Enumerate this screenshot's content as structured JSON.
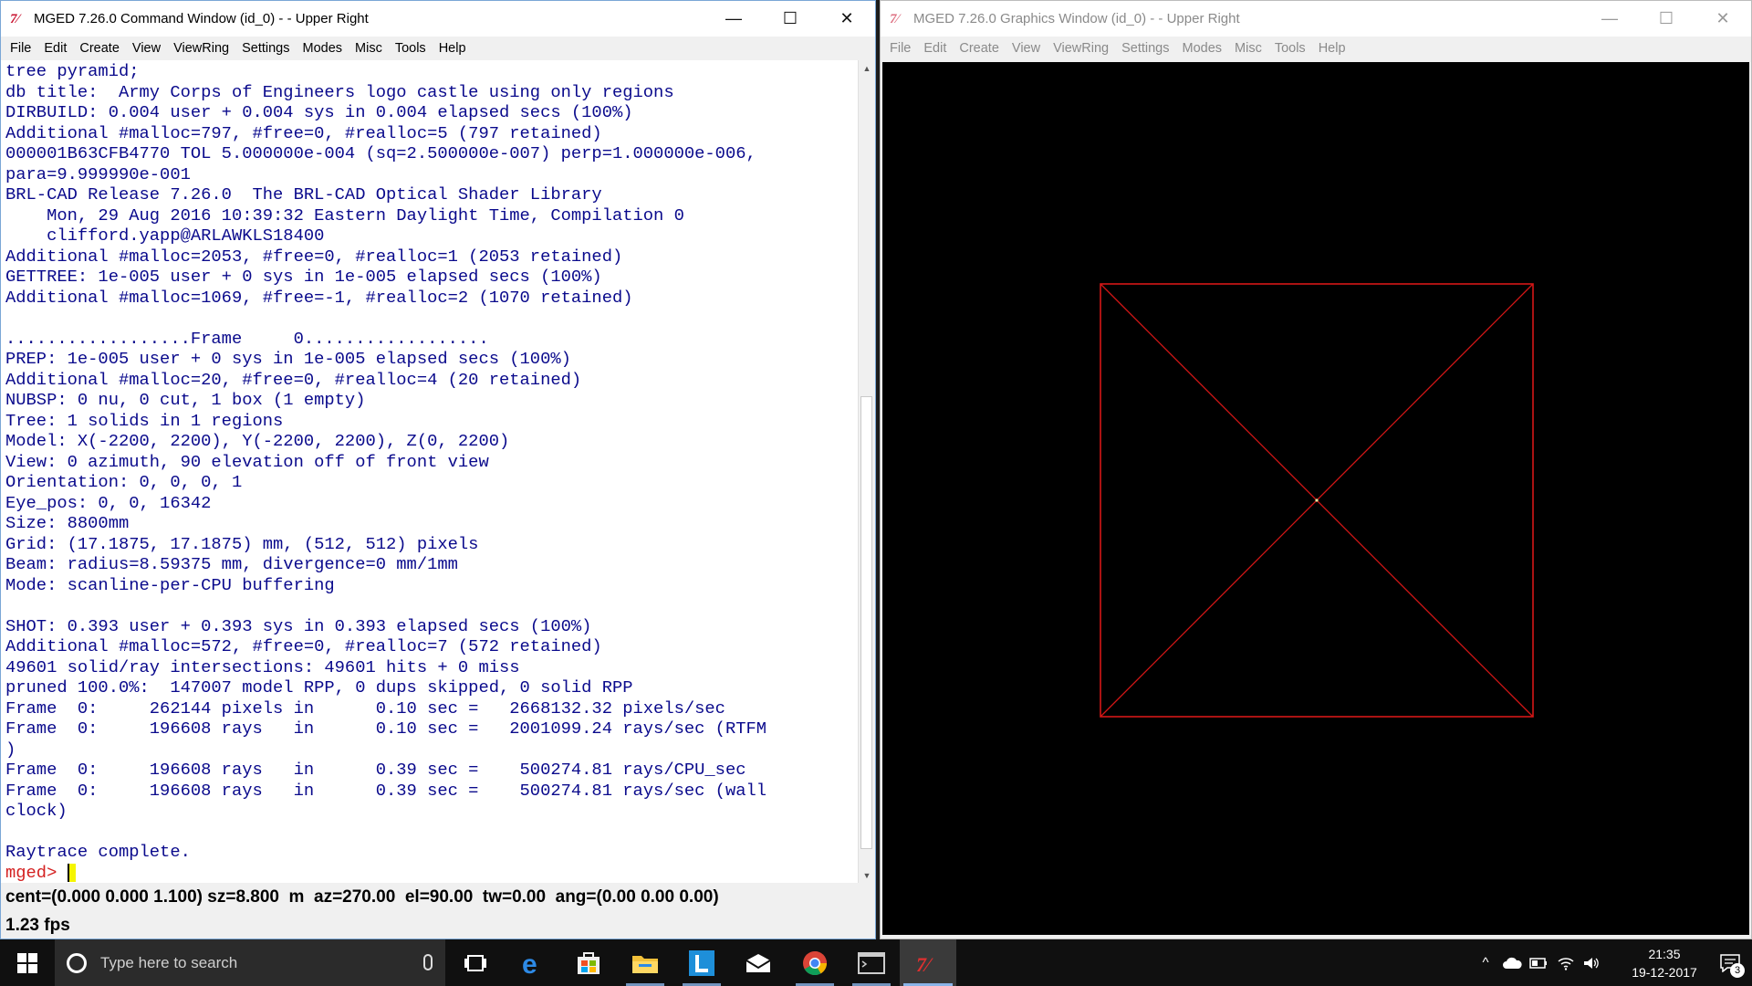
{
  "command_window": {
    "title": "MGED 7.26.0 Command Window (id_0) -  - Upper Right",
    "icon_glyph": "7⁄",
    "controls": {
      "minimize": "—",
      "maximize": "☐",
      "close": "✕"
    },
    "menu": [
      "File",
      "Edit",
      "Create",
      "View",
      "ViewRing",
      "Settings",
      "Modes",
      "Misc",
      "Tools",
      "Help"
    ],
    "console_lines": [
      "tree pyramid;",
      "db title:  Army Corps of Engineers logo castle using only regions",
      "DIRBUILD: 0.004 user + 0.004 sys in 0.004 elapsed secs (100%)",
      "Additional #malloc=797, #free=0, #realloc=5 (797 retained)",
      "000001B63CFB4770 TOL 5.000000e-004 (sq=2.500000e-007) perp=1.000000e-006,",
      "para=9.999990e-001",
      "BRL-CAD Release 7.26.0  The BRL-CAD Optical Shader Library",
      "    Mon, 29 Aug 2016 10:39:32 Eastern Daylight Time, Compilation 0",
      "    clifford.yapp@ARLAWKLS18400",
      "Additional #malloc=2053, #free=0, #realloc=1 (2053 retained)",
      "GETTREE: 1e-005 user + 0 sys in 1e-005 elapsed secs (100%)",
      "Additional #malloc=1069, #free=-1, #realloc=2 (1070 retained)",
      "",
      "..................Frame     0..................",
      "PREP: 1e-005 user + 0 sys in 1e-005 elapsed secs (100%)",
      "Additional #malloc=20, #free=0, #realloc=4 (20 retained)",
      "NUBSP: 0 nu, 0 cut, 1 box (1 empty)",
      "Tree: 1 solids in 1 regions",
      "Model: X(-2200, 2200), Y(-2200, 2200), Z(0, 2200)",
      "View: 0 azimuth, 90 elevation off of front view",
      "Orientation: 0, 0, 0, 1",
      "Eye_pos: 0, 0, 16342",
      "Size: 8800mm",
      "Grid: (17.1875, 17.1875) mm, (512, 512) pixels",
      "Beam: radius=8.59375 mm, divergence=0 mm/1mm",
      "Mode: scanline-per-CPU buffering",
      "",
      "SHOT: 0.393 user + 0.393 sys in 0.393 elapsed secs (100%)",
      "Additional #malloc=572, #free=0, #realloc=7 (572 retained)",
      "49601 solid/ray intersections: 49601 hits + 0 miss",
      "pruned 100.0%:  147007 model RPP, 0 dups skipped, 0 solid RPP",
      "Frame  0:     262144 pixels in      0.10 sec =   2668132.32 pixels/sec",
      "Frame  0:     196608 rays   in      0.10 sec =   2001099.24 rays/sec (RTFM",
      ")",
      "Frame  0:     196608 rays   in      0.39 sec =    500274.81 rays/CPU_sec",
      "Frame  0:     196608 rays   in      0.39 sec =    500274.81 rays/sec (wall",
      "clock)",
      "",
      "Raytrace complete."
    ],
    "prompt": "mged>",
    "status_view": "cent=(0.000 0.000 1.100) sz=8.800  m  az=270.00  el=90.00  tw=0.00  ang=(0.00 0.00 0.00)",
    "status_fps": "1.23 fps",
    "scroll_up_glyph": "▲",
    "scroll_down_glyph": "▼"
  },
  "graphics_window": {
    "title": "MGED 7.26.0 Graphics Window (id_0) -  - Upper Right",
    "icon_glyph": "7⁄",
    "controls": {
      "minimize": "—",
      "maximize": "☐",
      "close": "✕"
    },
    "menu": [
      "File",
      "Edit",
      "Create",
      "View",
      "ViewRing",
      "Settings",
      "Modes",
      "Misc",
      "Tools",
      "Help"
    ],
    "wireframe_color": "#d41616",
    "center_dot_color": "#e8e8a0"
  },
  "taskbar": {
    "search_placeholder": "Type here to search",
    "apps": [
      "task-view",
      "edge",
      "store",
      "file-explorer",
      "l-app",
      "mail",
      "chrome",
      "terminal",
      "mged"
    ],
    "tray_chevron": "^",
    "clock_time": "21:35",
    "clock_date": "19-12-2017",
    "notification_count": "3"
  },
  "colors": {
    "console_text": "#0a0a8c",
    "prompt": "#d42020",
    "cursor": "#f5f500",
    "canvas_bg": "#000000"
  }
}
